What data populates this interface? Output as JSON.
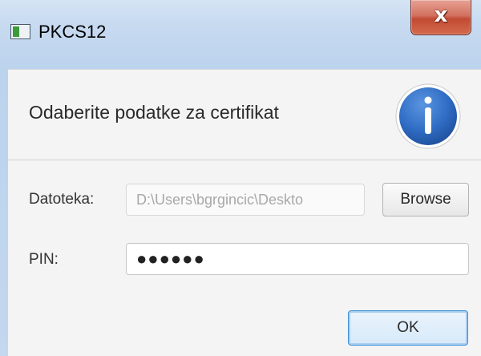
{
  "window": {
    "title": "PKCS12",
    "close_glyph": "x"
  },
  "header": {
    "message": "Odaberite podatke za certifikat",
    "icon": "info-icon",
    "icon_color": "#2f6cc4"
  },
  "form": {
    "file_label": "Datoteka:",
    "file_value": "D:\\Users\\bgrgincic\\Deskto",
    "browse_label": "Browse",
    "pin_label": "PIN:",
    "pin_value": "●●●●●●"
  },
  "footer": {
    "ok_label": "OK"
  },
  "colors": {
    "titlebar": "#c7daf0",
    "close": "#c24a33",
    "ok_border": "#3c8fd6"
  }
}
